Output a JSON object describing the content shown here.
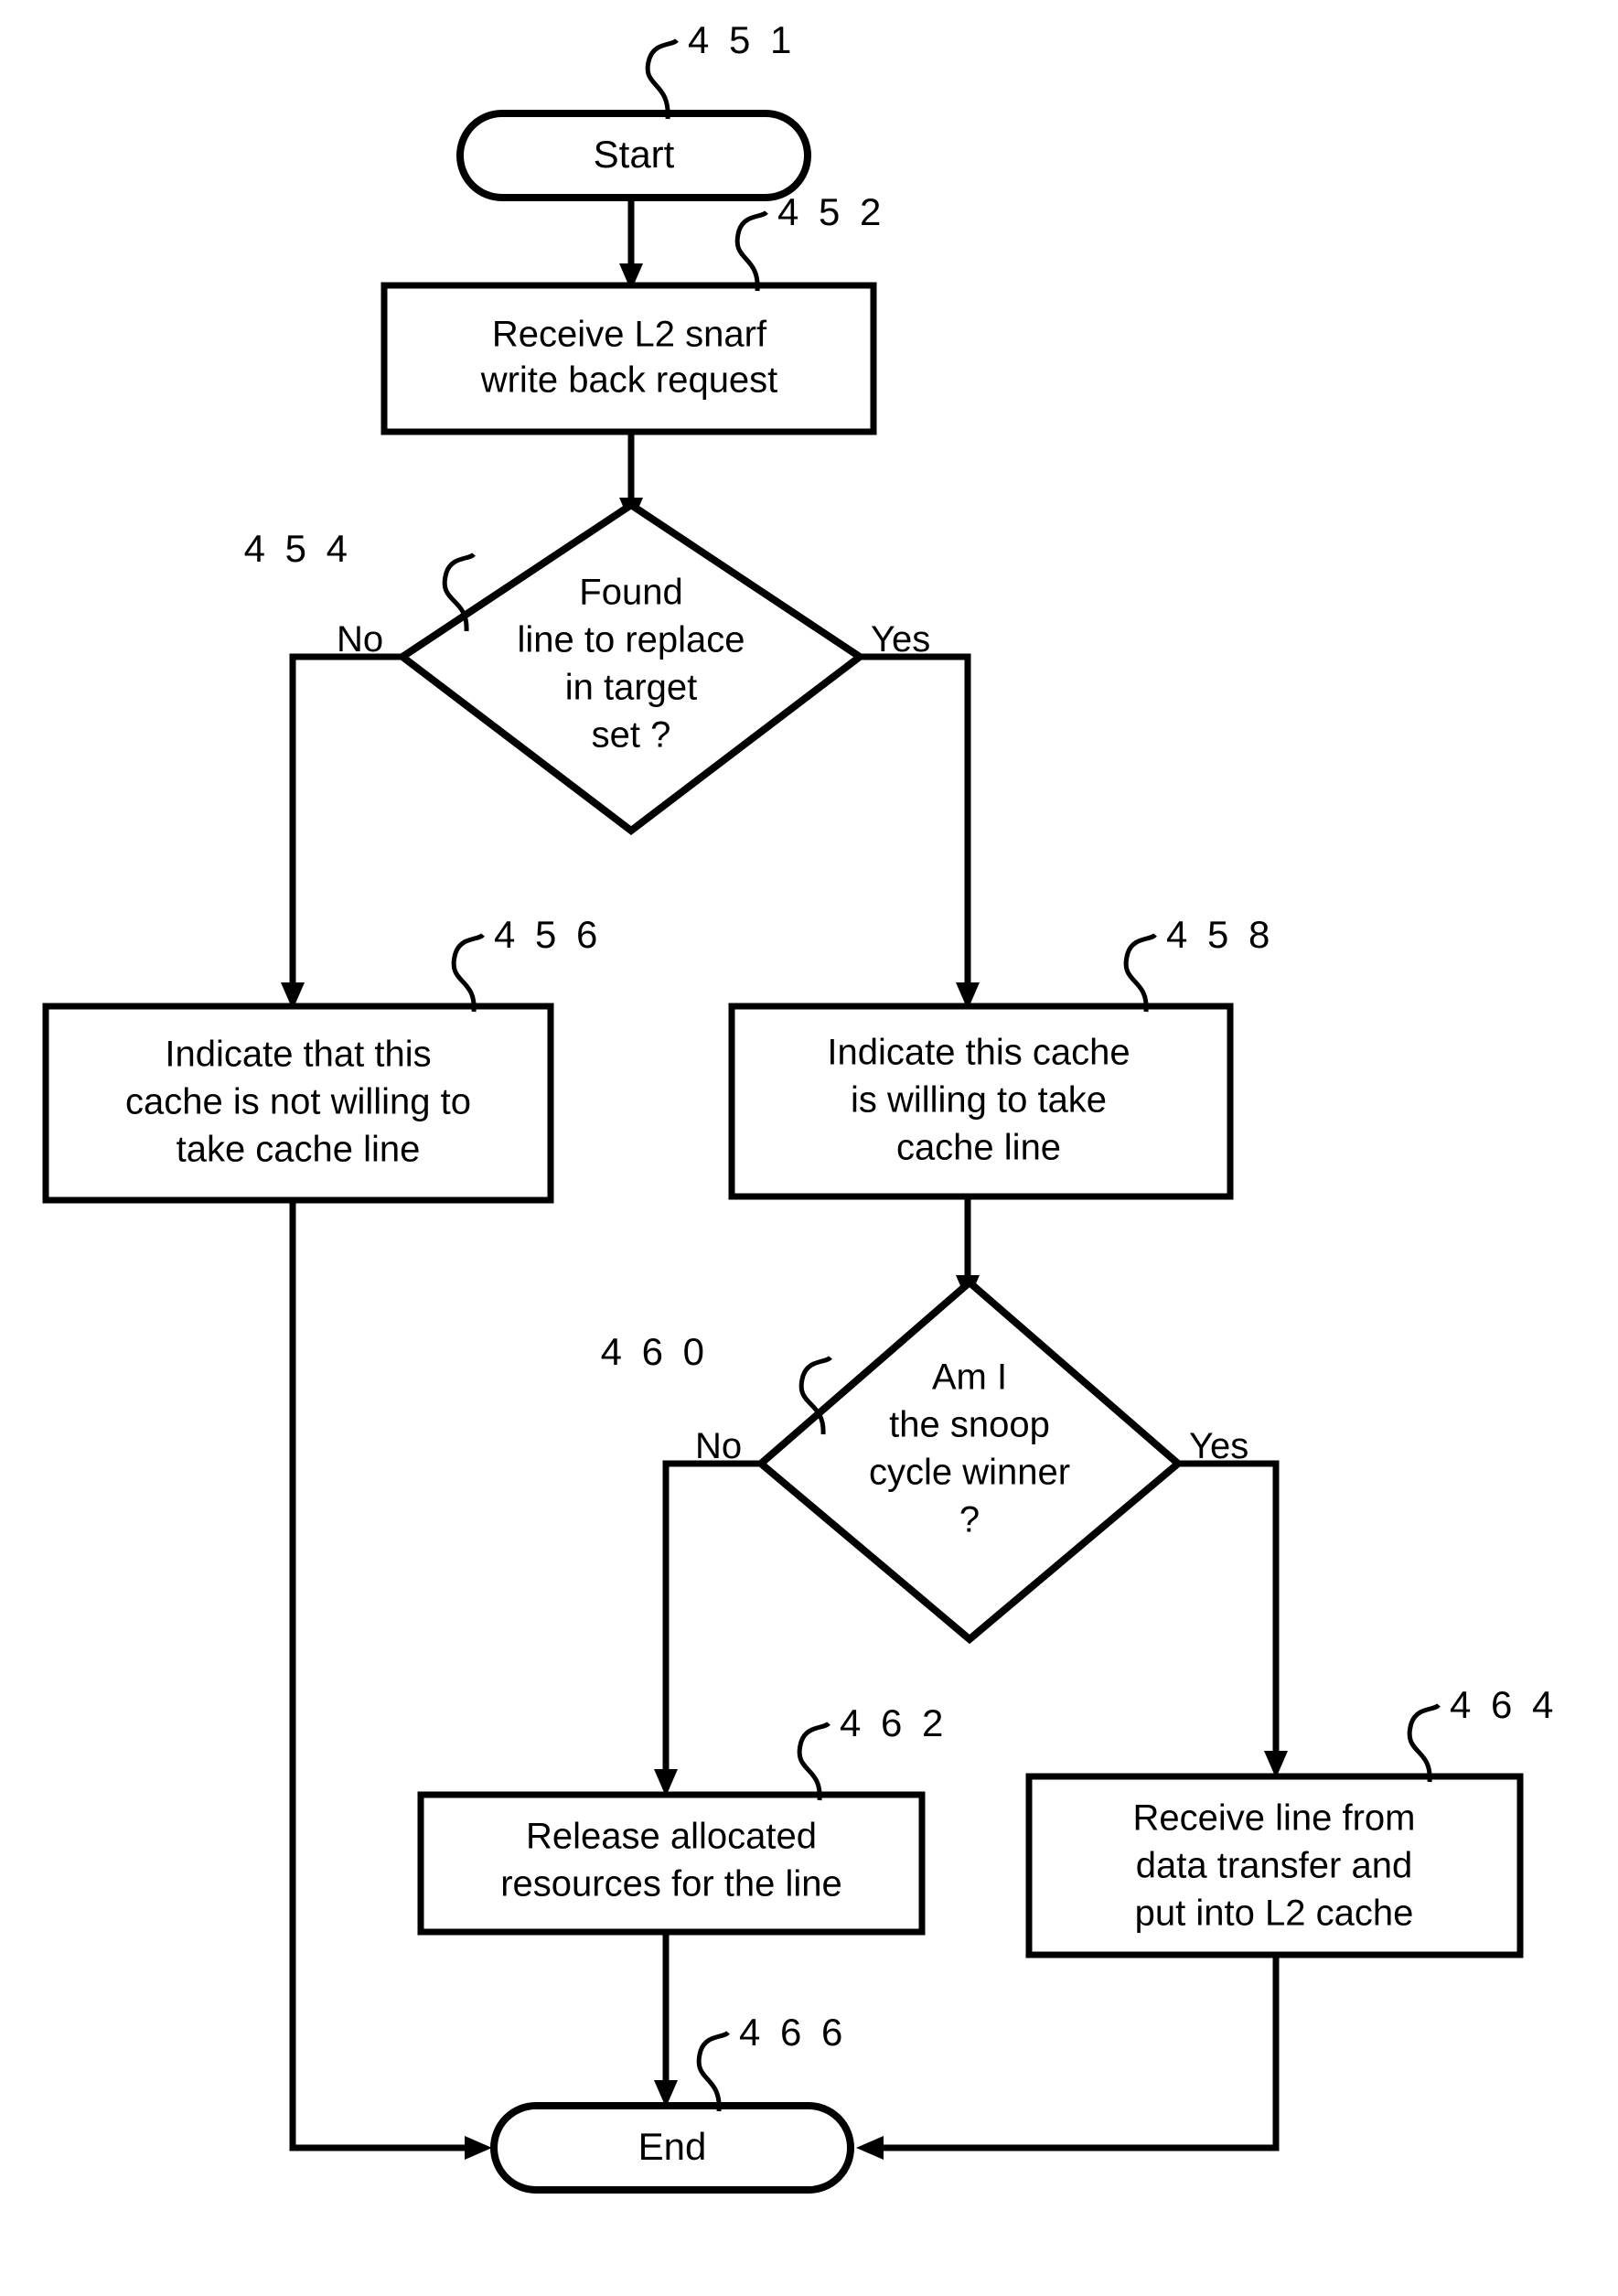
{
  "figure": {
    "type": "flowchart",
    "title": "L2 snarf write back request handling flowchart",
    "background": "#ffffff",
    "stroke_color": "#000000"
  },
  "nodes": [
    {
      "id": "451",
      "ref": "4 5 1",
      "shape": "terminal",
      "lines": [
        "Start"
      ]
    },
    {
      "id": "452",
      "ref": "4 5 2",
      "shape": "process",
      "lines": [
        "Receive L2 snarf",
        "write back request"
      ]
    },
    {
      "id": "454",
      "ref": "4 5 4",
      "shape": "decision",
      "lines": [
        "Found",
        "line to replace",
        "in target",
        "set ?"
      ]
    },
    {
      "id": "456",
      "ref": "4 5 6",
      "shape": "process",
      "lines": [
        "Indicate that this",
        "cache is not willing to",
        "take cache line"
      ]
    },
    {
      "id": "458",
      "ref": "4 5 8",
      "shape": "process",
      "lines": [
        "Indicate this cache",
        "is willing to take",
        "cache line"
      ]
    },
    {
      "id": "460",
      "ref": "4 6 0",
      "shape": "decision",
      "lines": [
        "Am I",
        "the snoop",
        "cycle winner",
        "?"
      ]
    },
    {
      "id": "462",
      "ref": "4 6 2",
      "shape": "process",
      "lines": [
        "Release allocated",
        "resources for the line"
      ]
    },
    {
      "id": "464",
      "ref": "4 6 4",
      "shape": "process",
      "lines": [
        "Receive line from",
        "data transfer and",
        "put into L2 cache"
      ]
    },
    {
      "id": "466",
      "ref": "4 6 6",
      "shape": "terminal",
      "lines": [
        "End"
      ]
    }
  ],
  "branch_labels": {
    "d454_no": "No",
    "d454_yes": "Yes",
    "d460_no": "No",
    "d460_yes": "Yes"
  },
  "edges": [
    {
      "from": "451",
      "to": "452",
      "label": ""
    },
    {
      "from": "452",
      "to": "454",
      "label": ""
    },
    {
      "from": "454",
      "to": "456",
      "label": "No"
    },
    {
      "from": "454",
      "to": "458",
      "label": "Yes"
    },
    {
      "from": "458",
      "to": "460",
      "label": ""
    },
    {
      "from": "460",
      "to": "462",
      "label": "No"
    },
    {
      "from": "460",
      "to": "464",
      "label": "Yes"
    },
    {
      "from": "456",
      "to": "466",
      "label": ""
    },
    {
      "from": "462",
      "to": "466",
      "label": ""
    },
    {
      "from": "464",
      "to": "466",
      "label": ""
    }
  ]
}
